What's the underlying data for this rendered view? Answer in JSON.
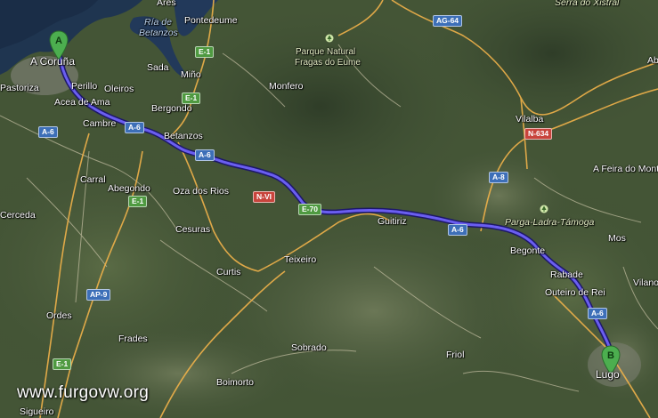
{
  "map": {
    "places": {
      "a_coruna": "A Coruña",
      "pastoriza": "Pastoriza",
      "perillo": "Perillo",
      "oleiros": "Oleiros",
      "acea_de_ama": "Acea de Ama",
      "cambre": "Cambre",
      "sada": "Sada",
      "mino": "Miño",
      "bergondo": "Bergondo",
      "betanzos": "Betanzos",
      "ares": "Ares",
      "pontedeume": "Pontedeume",
      "monfero": "Monfero",
      "carral": "Carral",
      "abegondo": "Abegondo",
      "oza_dos_rios": "Oza dos Rios",
      "cerceda": "Cerceda",
      "cesuras": "Cesuras",
      "curtis": "Curtis",
      "teixeiro": "Teixeiro",
      "guitiriz": "Guitiriz",
      "ordes": "Ordes",
      "frades": "Frades",
      "sobrado": "Sobrado",
      "boimorto": "Boimorto",
      "sigueiro": "Sigueiro",
      "vilalba": "Vilalba",
      "a_feira_do_monte": "A Feira do Monte",
      "begonte": "Begonte",
      "rabade": "Rabade",
      "outeiro_de_rei": "Outeiro de Rei",
      "mos": "Mos",
      "vilanova": "Vilano",
      "friol": "Friol",
      "lugo": "Lugo",
      "ab": "Ab"
    },
    "water": {
      "ria_de_betanzos_1": "Ría de",
      "ria_de_betanzos_2": "Betanzos"
    },
    "parks": {
      "fragas_1": "Parque Natural",
      "fragas_2": "Fragas do Eume",
      "parga": "Parga-Ladra-Támoga",
      "serra": "Serra do Xistral"
    },
    "roads": {
      "a6_1": "A-6",
      "a6_2": "A-6",
      "a6_3": "A-6",
      "a6_4": "A-6",
      "a6_5": "A-6",
      "e1_1": "E-1",
      "e1_2": "E-1",
      "e1_3": "E-1",
      "e70": "E-70",
      "nvi": "N-VI",
      "ag64": "AG-64",
      "n634": "N-634",
      "a8": "A-8",
      "ap9": "AP-9"
    },
    "markers": {
      "start": "A",
      "end": "B"
    },
    "watermark": "www.furgovw.org",
    "colors": {
      "route": "#5b4fd6",
      "road_major": "#f0b24a",
      "shield_blue": "#3d6fb8",
      "shield_green": "#4f9a41",
      "shield_red": "#c8443c",
      "marker": "#4cae4f"
    }
  }
}
